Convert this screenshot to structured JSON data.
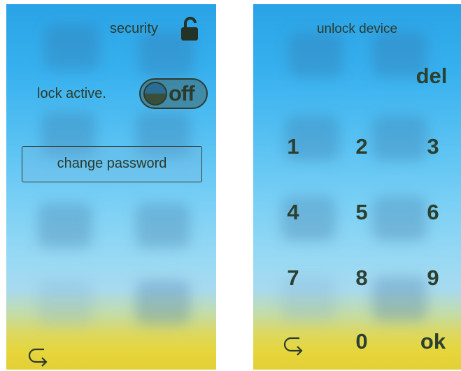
{
  "left_screen": {
    "header": {
      "title": "security",
      "icon": "lock-open-icon"
    },
    "lock": {
      "label": "lock active.",
      "toggle_state": "off"
    },
    "change_password_label": "change password",
    "back_icon": "back-arrow-icon"
  },
  "right_screen": {
    "title": "unlock device",
    "keypad": {
      "del": "del",
      "k1": "1",
      "k2": "2",
      "k3": "3",
      "k4": "4",
      "k5": "5",
      "k6": "6",
      "k7": "7",
      "k8": "8",
      "k9": "9",
      "k0": "0",
      "ok": "ok"
    },
    "back_icon": "back-arrow-icon"
  },
  "colors": {
    "text": "#2b3a2d",
    "sky_top": "#2aa3e6",
    "ground": "#e3cf36"
  }
}
